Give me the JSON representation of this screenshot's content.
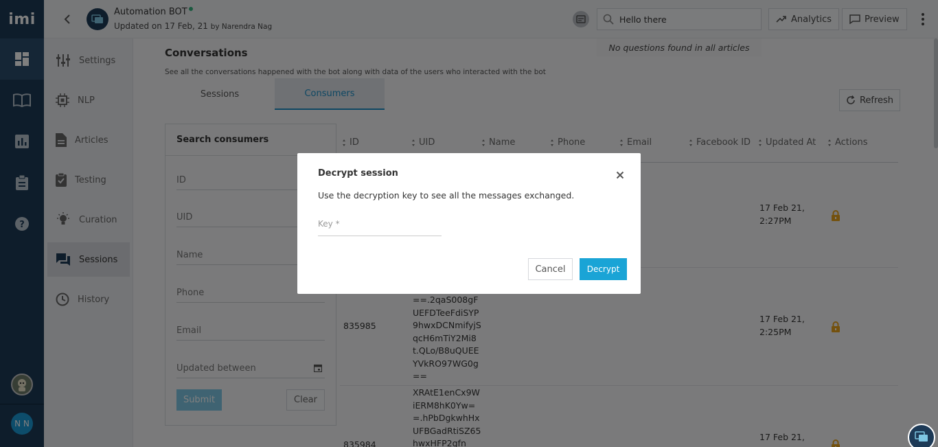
{
  "rail": {
    "logo": "imi",
    "user_initials": "N N"
  },
  "header": {
    "bot_name": "Automation BOT",
    "updated_prefix": "Updated on 17 Feb, 21",
    "updated_by": "by Narendra Nag",
    "search_value": "Hello there",
    "analytics_label": "Analytics",
    "preview_label": "Preview",
    "no_questions": "No questions found in all articles"
  },
  "sidebar": {
    "items": [
      {
        "label": "Settings",
        "icon": "sliders-icon"
      },
      {
        "label": "NLP",
        "icon": "chip-icon"
      },
      {
        "label": "Articles",
        "icon": "document-icon"
      },
      {
        "label": "Testing",
        "icon": "clipboard-check-icon"
      },
      {
        "label": "Curation",
        "icon": "lightbulb-icon"
      },
      {
        "label": "Sessions",
        "icon": "chat-icon"
      },
      {
        "label": "History",
        "icon": "history-icon"
      }
    ],
    "active": "Sessions"
  },
  "main": {
    "title": "Conversations",
    "description": "See all the conversations happened with the bot along with data of the users who interacted with the bot",
    "tabs": [
      {
        "label": "Sessions"
      },
      {
        "label": "Consumers"
      }
    ],
    "active_tab": "Consumers",
    "refresh_label": "Refresh"
  },
  "search_panel": {
    "title": "Search consumers",
    "fields": [
      "ID",
      "UID",
      "Name",
      "Phone",
      "Email",
      "Updated between"
    ],
    "submit_label": "Submit",
    "clear_label": "Clear"
  },
  "table": {
    "columns": [
      "ID",
      "UID",
      "Name",
      "Phone",
      "Email",
      "Facebook ID",
      "Updated At",
      "Actions"
    ],
    "rows": [
      {
        "id": "",
        "uid": "",
        "updated_date": "17 Feb 21,",
        "updated_time": "2:27PM"
      },
      {
        "id": "835985",
        "uid": "==.2qaS008gFUEFDTeeFdiSYP9hwxDCNmifyjSqcH6mTiY2Mi8t.QLo/B8uQUEEYVkRO97WG0g==",
        "updated_date": "17 Feb 21,",
        "updated_time": "2:25PM"
      },
      {
        "id": "835984",
        "uid": "XRAtE1enCx9WiERM8hK0Yw==.hPbDgkwhHxUFBGadRtiSZ65hwxHFP2gfn",
        "updated_date": "17 Feb 21,",
        "updated_time": ""
      }
    ]
  },
  "modal": {
    "title": "Decrypt session",
    "description": "Use the decryption key to see all the messages exchanged.",
    "key_placeholder": "Key *",
    "cancel_label": "Cancel",
    "decrypt_label": "Decrypt"
  },
  "colors": {
    "rail": "#1d3a57",
    "accent": "#1aa4d6",
    "lock": "#e8a21a"
  }
}
